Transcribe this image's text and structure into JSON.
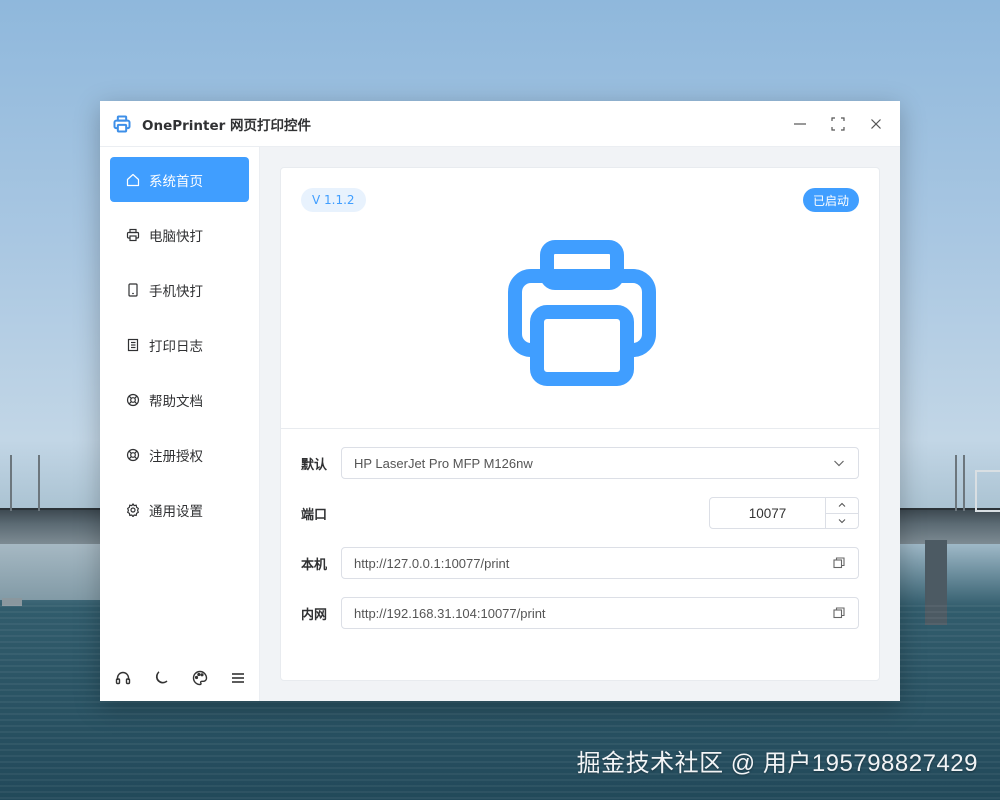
{
  "window": {
    "title": "OnePrinter 网页打印控件"
  },
  "sidebar": {
    "items": [
      {
        "label": "系统首页",
        "icon": "home-icon",
        "active": true
      },
      {
        "label": "电脑快打",
        "icon": "printer-icon",
        "active": false
      },
      {
        "label": "手机快打",
        "icon": "mobile-icon",
        "active": false
      },
      {
        "label": "打印日志",
        "icon": "document-icon",
        "active": false
      },
      {
        "label": "帮助文档",
        "icon": "help-buoy-icon",
        "active": false
      },
      {
        "label": "注册授权",
        "icon": "license-buoy-icon",
        "active": false
      },
      {
        "label": "通用设置",
        "icon": "gear-icon",
        "active": false
      }
    ],
    "footer_icons": [
      "headset-icon",
      "moon-icon",
      "palette-icon",
      "menu-icon"
    ]
  },
  "main": {
    "version": "V 1.1.2",
    "status": "已启动",
    "default_label": "默认",
    "default_printer": "HP LaserJet Pro MFP M126nw",
    "port_label": "端口",
    "port_value": "10077",
    "local_label": "本机",
    "local_url": "http://127.0.0.1:10077/print",
    "lan_label": "内网",
    "lan_url": "http://192.168.31.104:10077/print"
  },
  "watermark": "掘金技术社区 @ 用户195798827429",
  "colors": {
    "accent": "#409eff",
    "icon_blue": "#3d8fe8"
  }
}
